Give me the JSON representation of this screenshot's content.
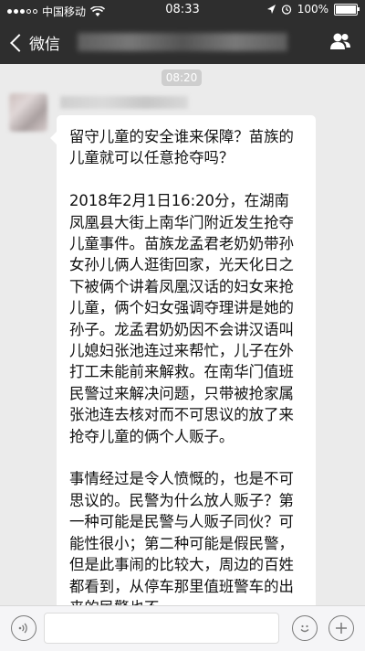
{
  "status_bar": {
    "carrier": "中国移动",
    "time": "08:33",
    "battery": "100%"
  },
  "nav": {
    "back_label": "微信"
  },
  "chat": {
    "timestamp": "08:20",
    "message": {
      "paragraphs": [
        "留守儿童的安全谁来保障？苗族的儿童就可以任意抢夺吗？",
        "2018年2月1日16:20分，在湖南凤凰县大街上南华门附近发生抢夺儿童事件。苗族龙孟君老奶奶带孙女孙儿俩人逛街回家，光天化日之下被俩个讲着凤凰汉话的妇女来抢儿童，俩个妇女强调夺理讲是她的孙子。龙孟君奶奶因不会讲汉语叫儿媳妇张池连过来帮忙，儿子在外打工未能前来解救。在南华门值班民警过来解决问题，只带被抢家属张池连去核对而不可思议的放了来抢夺儿童的俩个人贩子。",
        "事情经过是令人愤慨的，也是不可思议的。民警为什么放人贩子？第一种可能是民警与人贩子同伙？可能性很小；第二种可能是假民警，但是此事闹的比较大，周边的百姓都看到，从停车那里值班警车的出来的民警也不"
      ]
    }
  }
}
